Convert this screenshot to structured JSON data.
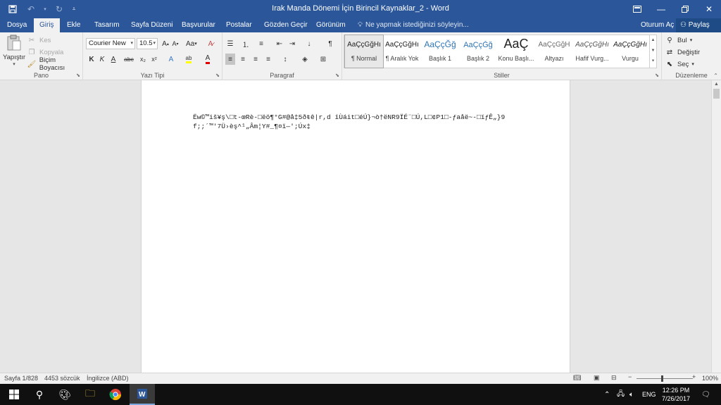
{
  "window": {
    "title": "Irak Manda Dönemi İçin Birincil Kaynaklar_2 - Word",
    "colors": {
      "brand": "#2b579a",
      "ribbon": "#f1f1f1",
      "canvas": "#e6e6e6"
    }
  },
  "tabs": [
    {
      "label": "Dosya"
    },
    {
      "label": "Giriş"
    },
    {
      "label": "Ekle"
    },
    {
      "label": "Tasarım"
    },
    {
      "label": "Sayfa Düzeni"
    },
    {
      "label": "Başvurular"
    },
    {
      "label": "Postalar"
    },
    {
      "label": "Gözden Geçir"
    },
    {
      "label": "Görünüm"
    }
  ],
  "tell_me": "Ne yapmak istediğinizi söyleyin...",
  "account": {
    "signin": "Oturum Aç",
    "share": "Paylaş"
  },
  "clipboard": {
    "paste": "Yapıştır",
    "cut": "Kes",
    "copy": "Kopyala",
    "format_painter": "Biçim Boyacısı",
    "label": "Pano"
  },
  "font": {
    "name": "Courier New",
    "size": "10.5",
    "label": "Yazı Tipi",
    "case": "Aa",
    "bold": "K",
    "italic": "K",
    "underline": "A",
    "strike": "abc",
    "sub": "x₂",
    "sup": "x²"
  },
  "paragraph": {
    "label": "Paragraf"
  },
  "styles": {
    "label": "Stiller",
    "items": [
      {
        "sample": "AaÇçĞğHı",
        "label": "¶ Normal"
      },
      {
        "sample": "AaÇçĞğHı",
        "label": "¶ Aralık Yok"
      },
      {
        "sample": "AaÇçĞğ",
        "label": "Başlık 1"
      },
      {
        "sample": "AaÇçĞğ",
        "label": "Başlık 2"
      },
      {
        "sample": "AaÇ",
        "label": "Konu Başlı..."
      },
      {
        "sample": "AaÇçĞğH",
        "label": "Altyazı"
      },
      {
        "sample": "AaÇçĞğHı",
        "label": "Hafif Vurg..."
      },
      {
        "sample": "AaÇçĞğHı",
        "label": "Vurgu"
      }
    ]
  },
  "editing": {
    "find": "Bul",
    "replace": "Değiştir",
    "select": "Seç",
    "label": "Düzenleme"
  },
  "document": {
    "text": "Ëw©™iš¥ş\\□t-œRè-□ëö¶°G#@å‡5ðŧê|r,d îÙáit□éÚ}¬ò†ëNR9ÏÉ¨□Ú,L□¢P1□-ƒaåë~-□ïƒÊ„}9f;;´™'7Ü›èş^¹„Âm¦Y#_¶¤ï—';Úx‡"
  },
  "status": {
    "page": "Sayfa 1/828",
    "words": "4453 sözcük",
    "language": "İngilizce (ABD)",
    "zoom": "100%"
  },
  "taskbar": {
    "language": "ENG",
    "time": "12:26 PM",
    "date": "7/26/2017"
  }
}
